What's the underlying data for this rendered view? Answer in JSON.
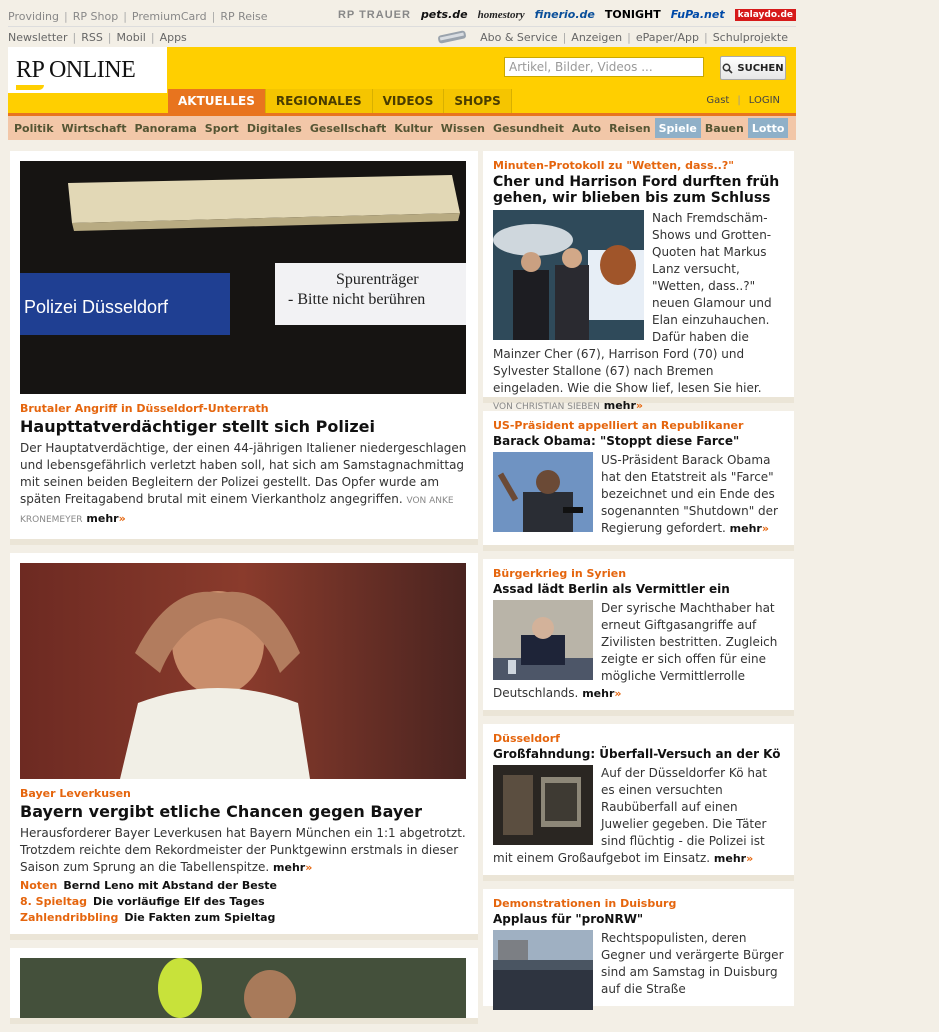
{
  "toplinks": [
    "Providing",
    "RP Shop",
    "PremiumCard",
    "RP Reise"
  ],
  "partners": [
    "RP TRAUER",
    "pets.de",
    "homestory",
    "finerio.de",
    "TONIGHT",
    "FuPa.net",
    "kalaydo.de"
  ],
  "secondlinks": [
    "Newsletter",
    "RSS",
    "Mobil",
    "Apps"
  ],
  "secondright": [
    "Abo & Service",
    "Anzeigen",
    "ePaper/App",
    "Schulprojekte"
  ],
  "logo": "RP ONLINE",
  "search": {
    "placeholder": "Artikel, Bilder, Videos ...",
    "button": "SUCHEN"
  },
  "mainnav": [
    "AKTUELLES",
    "REGIONALES",
    "VIDEOS",
    "SHOPS"
  ],
  "user": {
    "gast": "Gast",
    "login": "LOGIN"
  },
  "subnav": [
    "Politik",
    "Wirtschaft",
    "Panorama",
    "Sport",
    "Digitales",
    "Gesellschaft",
    "Kultur",
    "Wissen",
    "Gesundheit",
    "Auto",
    "Reisen",
    "Spiele",
    "Bauen",
    "Lotto"
  ],
  "colors": {
    "brand_yellow": "#ffcf00",
    "accent_orange": "#e8741e",
    "kicker": "#e5650d"
  },
  "lead1": {
    "img_text_left": "Polizei Düsseldorf",
    "img_text_right1": "Spurenträger",
    "img_text_right2": "- Bitte nicht berühren",
    "kicker": "Brutaler Angriff in Düsseldorf-Unterrath",
    "headline": "Haupttatverdächtiger stellt sich Polizei",
    "teaser": "Der Hauptatverdächtige, der einen 44-jährigen Italiener niedergeschlagen und lebensgefährlich verletzt haben soll, hat sich am Samstagnachmittag mit seinen beiden Begleitern der Polizei gestellt. Das Opfer wurde am späten Freitagabend brutal mit einem Vierkantholz angegriffen.",
    "byline": "VON ANKE KRONEMEYER",
    "mehr": "mehr"
  },
  "lead2": {
    "kicker": "Bayer Leverkusen",
    "headline": "Bayern vergibt etliche Chancen gegen Bayer",
    "teaser": "Herausforderer Bayer Leverkusen hat Bayern München ein 1:1 abgetrotzt. Trotzdem reichte dem Rekordmeister der Punktgewinn erstmals in dieser Saison zum Sprung an die Tabellenspitze.",
    "mehr": "mehr",
    "related": [
      {
        "k": "Noten",
        "t": "Bernd Leno mit Abstand der Beste"
      },
      {
        "k": "8. Spieltag",
        "t": "Die vorläufige Elf des Tages"
      },
      {
        "k": "Zahlendribbling",
        "t": "Die Fakten zum Spieltag"
      }
    ]
  },
  "right": [
    {
      "kicker": "Minuten-Protokoll zu \"Wetten, dass..?\"",
      "headline": "Cher und Harrison Ford durften früh gehen, wir blieben bis zum Schluss",
      "body": "Nach Fremdschäm-Shows und Grotten-Quoten hat Markus Lanz versucht, \"Wetten, dass..?\" neuen Glamour und Elan einzuhauchen. Dafür haben die Mainzer Cher (67), Harrison Ford (70) und Sylvester Stallone (67) nach Bremen eingeladen. Wie die Show lief, lesen Sie hier.",
      "byline": "VON CHRISTIAN SIEBEN",
      "mehr": "mehr"
    },
    {
      "kicker": "US-Präsident appelliert an Republikaner",
      "headline": "Barack Obama: \"Stoppt diese Farce\"",
      "body": "US-Präsident Barack Obama hat den Etatstreit als \"Farce\" bezeichnet und ein Ende des sogenannten \"Shutdown\" der Regierung gefordert.",
      "mehr": "mehr"
    },
    {
      "kicker": "Bürgerkrieg in Syrien",
      "headline": "Assad lädt Berlin als Vermittler ein",
      "body": "Der syrische Machthaber hat erneut Giftgasangriffe auf Zivilisten bestritten. Zugleich zeigte er sich offen für eine mögliche Vermittlerrolle Deutschlands.",
      "mehr": "mehr"
    },
    {
      "kicker": "Düsseldorf",
      "headline": "Großfahndung: Überfall-Versuch an der Kö",
      "body": "Auf der Düsseldorfer Kö hat es einen versuchten Raubüberfall auf einen Juwelier gegeben. Die Täter sind flüchtig - die Polizei ist mit einem Großaufgebot im Einsatz.",
      "mehr": "mehr"
    },
    {
      "kicker": "Demonstrationen in Duisburg",
      "headline": "Applaus für \"proNRW\"",
      "body": "Rechtspopulisten, deren Gegner und verärgerte Bürger sind am Samstag in Duisburg auf die Straße"
    }
  ]
}
